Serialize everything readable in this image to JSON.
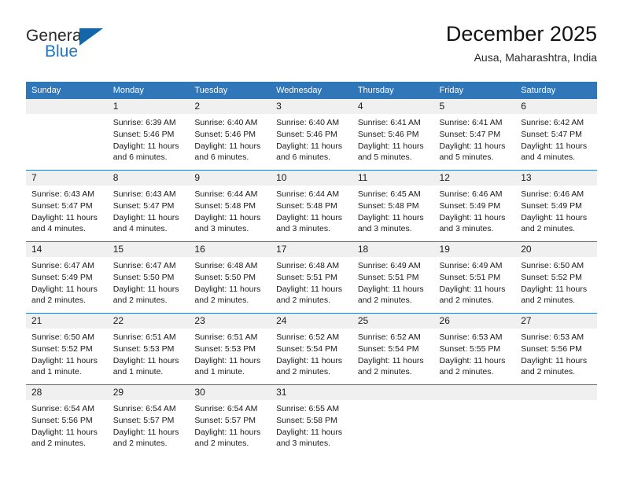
{
  "brand": {
    "name_part1": "General",
    "name_part2": "Blue",
    "accent_color": "#1d76c6",
    "mark_color": "#1466ab"
  },
  "header": {
    "title": "December 2025",
    "subtitle": "Ausa, Maharashtra, India"
  },
  "theme": {
    "header_row_bg": "#2f77b8",
    "header_row_text": "#ffffff",
    "daynum_band_bg": "#f0f0f0",
    "row_separator": "#2f77b8",
    "body_text": "#1a1a1a"
  },
  "weekday_headers": [
    "Sunday",
    "Monday",
    "Tuesday",
    "Wednesday",
    "Thursday",
    "Friday",
    "Saturday"
  ],
  "weeks": [
    [
      {
        "day": "",
        "lines": []
      },
      {
        "day": "1",
        "lines": [
          "Sunrise: 6:39 AM",
          "Sunset: 5:46 PM",
          "Daylight: 11 hours",
          "and 6 minutes."
        ]
      },
      {
        "day": "2",
        "lines": [
          "Sunrise: 6:40 AM",
          "Sunset: 5:46 PM",
          "Daylight: 11 hours",
          "and 6 minutes."
        ]
      },
      {
        "day": "3",
        "lines": [
          "Sunrise: 6:40 AM",
          "Sunset: 5:46 PM",
          "Daylight: 11 hours",
          "and 6 minutes."
        ]
      },
      {
        "day": "4",
        "lines": [
          "Sunrise: 6:41 AM",
          "Sunset: 5:46 PM",
          "Daylight: 11 hours",
          "and 5 minutes."
        ]
      },
      {
        "day": "5",
        "lines": [
          "Sunrise: 6:41 AM",
          "Sunset: 5:47 PM",
          "Daylight: 11 hours",
          "and 5 minutes."
        ]
      },
      {
        "day": "6",
        "lines": [
          "Sunrise: 6:42 AM",
          "Sunset: 5:47 PM",
          "Daylight: 11 hours",
          "and 4 minutes."
        ]
      }
    ],
    [
      {
        "day": "7",
        "lines": [
          "Sunrise: 6:43 AM",
          "Sunset: 5:47 PM",
          "Daylight: 11 hours",
          "and 4 minutes."
        ]
      },
      {
        "day": "8",
        "lines": [
          "Sunrise: 6:43 AM",
          "Sunset: 5:47 PM",
          "Daylight: 11 hours",
          "and 4 minutes."
        ]
      },
      {
        "day": "9",
        "lines": [
          "Sunrise: 6:44 AM",
          "Sunset: 5:48 PM",
          "Daylight: 11 hours",
          "and 3 minutes."
        ]
      },
      {
        "day": "10",
        "lines": [
          "Sunrise: 6:44 AM",
          "Sunset: 5:48 PM",
          "Daylight: 11 hours",
          "and 3 minutes."
        ]
      },
      {
        "day": "11",
        "lines": [
          "Sunrise: 6:45 AM",
          "Sunset: 5:48 PM",
          "Daylight: 11 hours",
          "and 3 minutes."
        ]
      },
      {
        "day": "12",
        "lines": [
          "Sunrise: 6:46 AM",
          "Sunset: 5:49 PM",
          "Daylight: 11 hours",
          "and 3 minutes."
        ]
      },
      {
        "day": "13",
        "lines": [
          "Sunrise: 6:46 AM",
          "Sunset: 5:49 PM",
          "Daylight: 11 hours",
          "and 2 minutes."
        ]
      }
    ],
    [
      {
        "day": "14",
        "lines": [
          "Sunrise: 6:47 AM",
          "Sunset: 5:49 PM",
          "Daylight: 11 hours",
          "and 2 minutes."
        ]
      },
      {
        "day": "15",
        "lines": [
          "Sunrise: 6:47 AM",
          "Sunset: 5:50 PM",
          "Daylight: 11 hours",
          "and 2 minutes."
        ]
      },
      {
        "day": "16",
        "lines": [
          "Sunrise: 6:48 AM",
          "Sunset: 5:50 PM",
          "Daylight: 11 hours",
          "and 2 minutes."
        ]
      },
      {
        "day": "17",
        "lines": [
          "Sunrise: 6:48 AM",
          "Sunset: 5:51 PM",
          "Daylight: 11 hours",
          "and 2 minutes."
        ]
      },
      {
        "day": "18",
        "lines": [
          "Sunrise: 6:49 AM",
          "Sunset: 5:51 PM",
          "Daylight: 11 hours",
          "and 2 minutes."
        ]
      },
      {
        "day": "19",
        "lines": [
          "Sunrise: 6:49 AM",
          "Sunset: 5:51 PM",
          "Daylight: 11 hours",
          "and 2 minutes."
        ]
      },
      {
        "day": "20",
        "lines": [
          "Sunrise: 6:50 AM",
          "Sunset: 5:52 PM",
          "Daylight: 11 hours",
          "and 2 minutes."
        ]
      }
    ],
    [
      {
        "day": "21",
        "lines": [
          "Sunrise: 6:50 AM",
          "Sunset: 5:52 PM",
          "Daylight: 11 hours",
          "and 1 minute."
        ]
      },
      {
        "day": "22",
        "lines": [
          "Sunrise: 6:51 AM",
          "Sunset: 5:53 PM",
          "Daylight: 11 hours",
          "and 1 minute."
        ]
      },
      {
        "day": "23",
        "lines": [
          "Sunrise: 6:51 AM",
          "Sunset: 5:53 PM",
          "Daylight: 11 hours",
          "and 1 minute."
        ]
      },
      {
        "day": "24",
        "lines": [
          "Sunrise: 6:52 AM",
          "Sunset: 5:54 PM",
          "Daylight: 11 hours",
          "and 2 minutes."
        ]
      },
      {
        "day": "25",
        "lines": [
          "Sunrise: 6:52 AM",
          "Sunset: 5:54 PM",
          "Daylight: 11 hours",
          "and 2 minutes."
        ]
      },
      {
        "day": "26",
        "lines": [
          "Sunrise: 6:53 AM",
          "Sunset: 5:55 PM",
          "Daylight: 11 hours",
          "and 2 minutes."
        ]
      },
      {
        "day": "27",
        "lines": [
          "Sunrise: 6:53 AM",
          "Sunset: 5:56 PM",
          "Daylight: 11 hours",
          "and 2 minutes."
        ]
      }
    ],
    [
      {
        "day": "28",
        "lines": [
          "Sunrise: 6:54 AM",
          "Sunset: 5:56 PM",
          "Daylight: 11 hours",
          "and 2 minutes."
        ]
      },
      {
        "day": "29",
        "lines": [
          "Sunrise: 6:54 AM",
          "Sunset: 5:57 PM",
          "Daylight: 11 hours",
          "and 2 minutes."
        ]
      },
      {
        "day": "30",
        "lines": [
          "Sunrise: 6:54 AM",
          "Sunset: 5:57 PM",
          "Daylight: 11 hours",
          "and 2 minutes."
        ]
      },
      {
        "day": "31",
        "lines": [
          "Sunrise: 6:55 AM",
          "Sunset: 5:58 PM",
          "Daylight: 11 hours",
          "and 3 minutes."
        ]
      },
      {
        "day": "",
        "lines": []
      },
      {
        "day": "",
        "lines": []
      },
      {
        "day": "",
        "lines": []
      }
    ]
  ]
}
